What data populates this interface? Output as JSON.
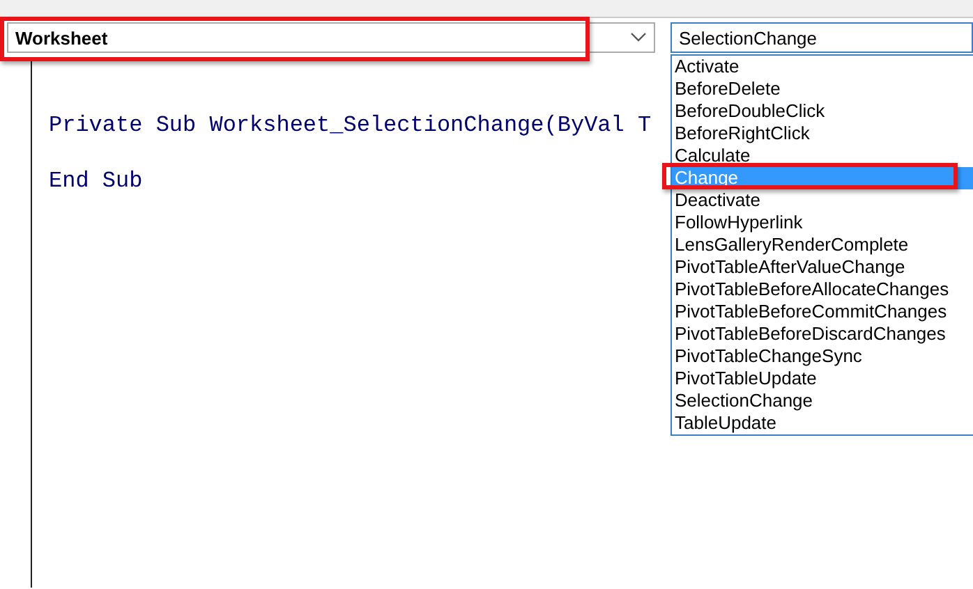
{
  "object_box": {
    "value": "Worksheet",
    "highlighted": true
  },
  "procedure_box": {
    "value": "SelectionChange"
  },
  "code_lines": [
    "Private Sub Worksheet_SelectionChange(ByVal T",
    "End Sub"
  ],
  "procedure_list": [
    {
      "label": "Activate",
      "selected": false,
      "highlighted": false
    },
    {
      "label": "BeforeDelete",
      "selected": false,
      "highlighted": false
    },
    {
      "label": "BeforeDoubleClick",
      "selected": false,
      "highlighted": false
    },
    {
      "label": "BeforeRightClick",
      "selected": false,
      "highlighted": false
    },
    {
      "label": "Calculate",
      "selected": false,
      "highlighted": false
    },
    {
      "label": "Change",
      "selected": true,
      "highlighted": true
    },
    {
      "label": "Deactivate",
      "selected": false,
      "highlighted": false
    },
    {
      "label": "FollowHyperlink",
      "selected": false,
      "highlighted": false
    },
    {
      "label": "LensGalleryRenderComplete",
      "selected": false,
      "highlighted": false
    },
    {
      "label": "PivotTableAfterValueChange",
      "selected": false,
      "highlighted": false
    },
    {
      "label": "PivotTableBeforeAllocateChanges",
      "selected": false,
      "highlighted": false
    },
    {
      "label": "PivotTableBeforeCommitChanges",
      "selected": false,
      "highlighted": false
    },
    {
      "label": "PivotTableBeforeDiscardChanges",
      "selected": false,
      "highlighted": false
    },
    {
      "label": "PivotTableChangeSync",
      "selected": false,
      "highlighted": false
    },
    {
      "label": "PivotTableUpdate",
      "selected": false,
      "highlighted": false
    },
    {
      "label": "SelectionChange",
      "selected": false,
      "highlighted": false
    },
    {
      "label": "TableUpdate",
      "selected": false,
      "highlighted": false
    }
  ]
}
